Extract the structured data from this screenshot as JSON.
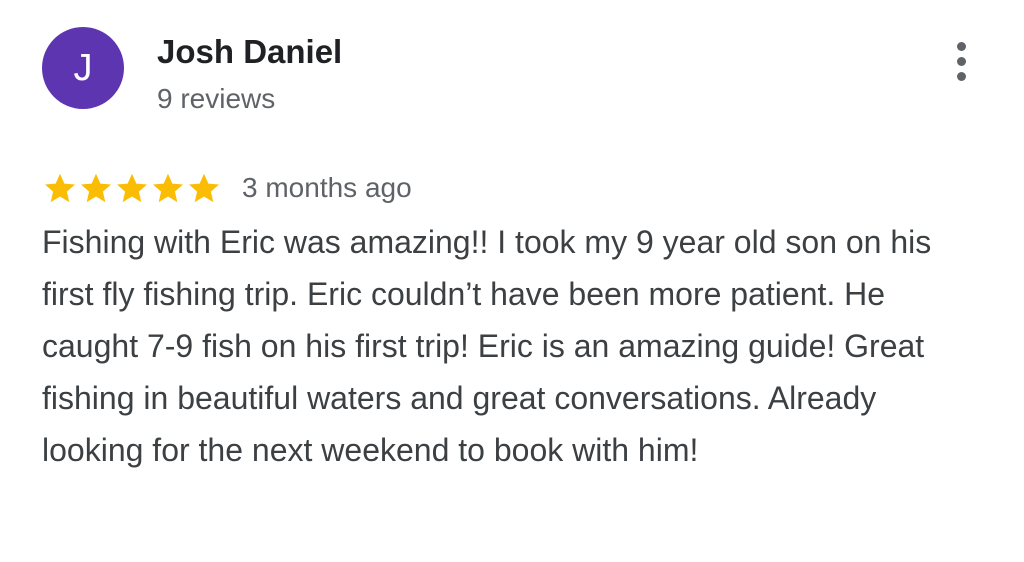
{
  "reviewer": {
    "initial": "J",
    "name": "Josh Daniel",
    "review_count": "9 reviews",
    "avatar_color": "#5e35b1"
  },
  "menu": {
    "icon": "more-vert-icon"
  },
  "review": {
    "rating": 5,
    "max_rating": 5,
    "star_color": "#fbbc04",
    "time": "3 months ago",
    "text": "Fishing with Eric was amazing!! I took my 9 year old son on his first fly fishing trip. Eric couldn’t have been more patient. He caught 7-9 fish on his first trip! Eric is an amazing guide! Great fishing in beautiful waters and great conversations. Already looking for the next weekend to book with him!"
  }
}
